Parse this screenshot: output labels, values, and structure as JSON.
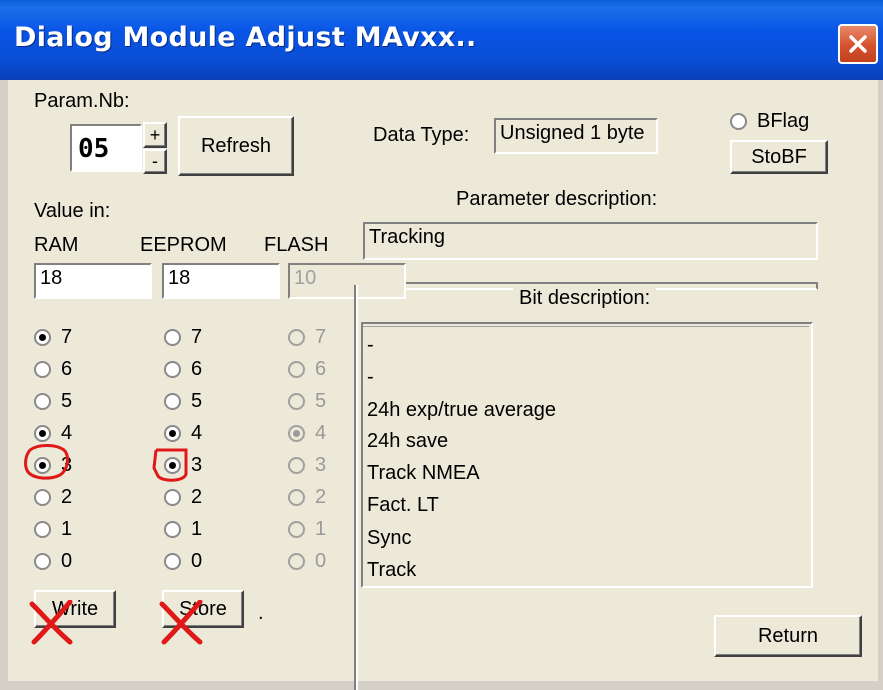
{
  "window": {
    "title": "Dialog Module Adjust MAvxx.."
  },
  "param": {
    "label": "Param.Nb:",
    "value": "05",
    "plus": "+",
    "minus": "-"
  },
  "refresh_label": "Refresh",
  "data_type": {
    "label": "Data Type:",
    "value": "Unsigned 1 byte"
  },
  "bflag": {
    "label": "BFlag",
    "stobf_label": "StoBF"
  },
  "value_in": {
    "label": "Value in:",
    "ram": "RAM",
    "eeprom": "EEPROM",
    "flash": "FLASH"
  },
  "fields": {
    "ram": "18",
    "eeprom": "18",
    "flash": "10"
  },
  "param_description": {
    "label": "Parameter description:",
    "value": "Tracking"
  },
  "bit_description": {
    "label": "Bit description:",
    "lines": [
      "-",
      "-",
      "24h exp/true average",
      "24h save",
      "Track NMEA",
      "Fact. LT",
      "Sync",
      "Track"
    ]
  },
  "bits": [
    "7",
    "6",
    "5",
    "4",
    "3",
    "2",
    "1",
    "0"
  ],
  "ram_bits_checked": [
    true,
    false,
    false,
    true,
    true,
    false,
    false,
    false
  ],
  "eeprom_bits_checked": [
    false,
    false,
    false,
    true,
    true,
    false,
    false,
    false
  ],
  "flash_bits_checked": [
    false,
    false,
    false,
    true,
    false,
    false,
    false,
    false
  ],
  "buttons": {
    "write": "Write",
    "store": "Store",
    "return": "Return",
    "dot": "."
  },
  "colors": {
    "title_bar": "#0a54e6",
    "annotation": "#e01818",
    "dialog_bg": "#ece9d8"
  }
}
